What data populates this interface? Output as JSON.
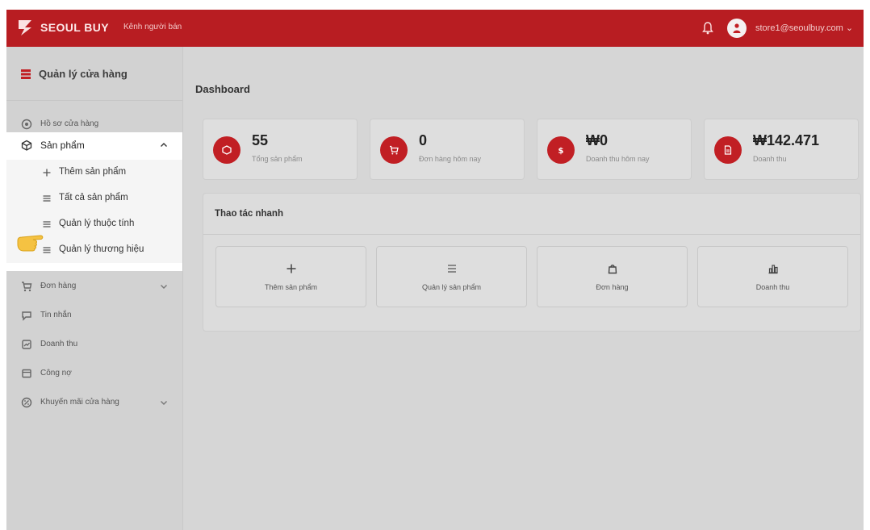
{
  "topbar": {
    "brand": "SEOUL BUY",
    "channel": "Kênh người bán",
    "email": "store1@seoulbuy.com",
    "accent_color": "#b81d22"
  },
  "sidebar": {
    "store_title": "Quản lý cửa hàng",
    "items_top": [
      {
        "label": "Hồ sơ cửa hàng",
        "icon": "store-profile-icon"
      }
    ],
    "products": {
      "label": "Sản phẩm",
      "icon": "box-icon",
      "expanded": true,
      "children": [
        {
          "label": "Thêm sản phẩm",
          "icon": "plus-icon"
        },
        {
          "label": "Tất cả sản phẩm",
          "icon": "list-icon"
        },
        {
          "label": "Quản lý thuộc tính",
          "icon": "list-icon"
        },
        {
          "label": "Quản lý thương hiệu",
          "icon": "list-icon"
        }
      ]
    },
    "items_bottom": [
      {
        "label": "Đơn hàng",
        "icon": "cart-icon",
        "has_children": true
      },
      {
        "label": "Tin nhắn",
        "icon": "chat-icon",
        "has_children": false
      },
      {
        "label": "Doanh thu",
        "icon": "revenue-icon",
        "has_children": false
      },
      {
        "label": "Công nợ",
        "icon": "debt-icon",
        "has_children": false
      },
      {
        "label": "Khuyến mãi cửa hàng",
        "icon": "promo-icon",
        "has_children": true
      }
    ]
  },
  "main": {
    "title": "Dashboard",
    "stats": [
      {
        "value": "55",
        "caption": "Tổng sản phẩm",
        "icon": "box-icon"
      },
      {
        "value": "0",
        "caption": "Đơn hàng hôm nay",
        "icon": "cart-icon"
      },
      {
        "value": "₩0",
        "caption": "Doanh thu hôm nay",
        "icon": "dollar-icon"
      },
      {
        "value": "₩142.471",
        "caption": "Doanh thu",
        "icon": "document-icon"
      }
    ],
    "quick_actions": {
      "title": "Thao tác nhanh",
      "buttons": [
        {
          "label": "Thêm sản phẩm",
          "icon": "plus-icon"
        },
        {
          "label": "Quản lý sản phẩm",
          "icon": "list-icon"
        },
        {
          "label": "Đơn hàng",
          "icon": "bag-icon"
        },
        {
          "label": "Doanh thu",
          "icon": "chart-icon"
        }
      ]
    }
  }
}
